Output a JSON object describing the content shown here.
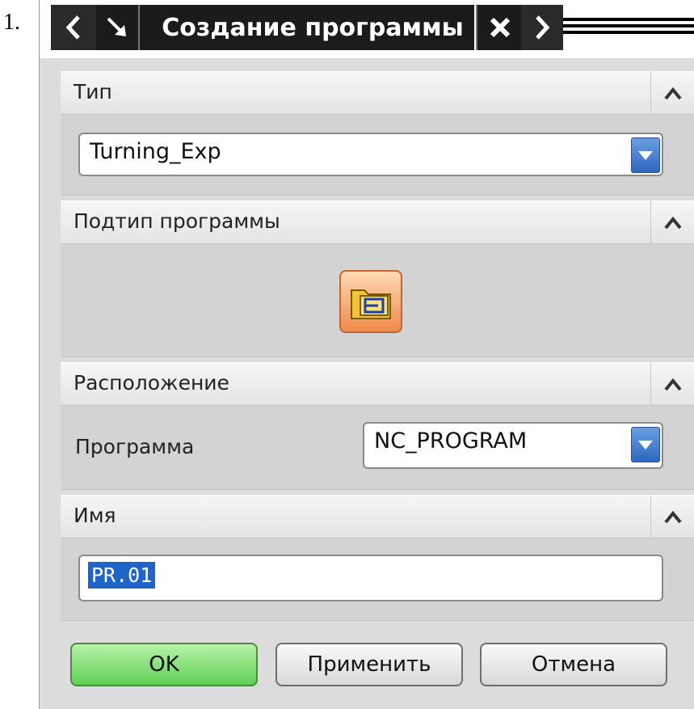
{
  "list_marker": "1.",
  "dialog": {
    "title": "Создание программы",
    "sections": {
      "type": {
        "header": "Тип",
        "value": "Turning_Exp"
      },
      "subtype": {
        "header": "Подтип программы",
        "icon": "program-folder-icon"
      },
      "location": {
        "header": "Расположение",
        "program_label": "Программа",
        "program_value": "NC_PROGRAM"
      },
      "name": {
        "header": "Имя",
        "value": "PR.01"
      }
    },
    "buttons": {
      "ok": "OK",
      "apply": "Применить",
      "cancel": "Отмена"
    }
  },
  "colors": {
    "title_bg": "#1b1b1b",
    "ok_button": "#5fcf55",
    "dropdown_accent": "#2f67c2",
    "selection": "#1f64c8"
  }
}
